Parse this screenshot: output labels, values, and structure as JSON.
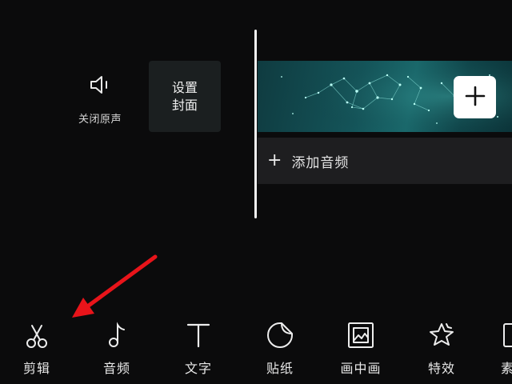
{
  "controls": {
    "mute_label": "关闭原声",
    "cover_line1": "设置",
    "cover_line2": "封面"
  },
  "timeline": {
    "add_audio_label": "添加音频"
  },
  "toolbar": {
    "items": [
      {
        "label": "剪辑",
        "icon": "scissors-icon"
      },
      {
        "label": "音频",
        "icon": "music-note-icon"
      },
      {
        "label": "文字",
        "icon": "text-icon"
      },
      {
        "label": "贴纸",
        "icon": "sticker-icon"
      },
      {
        "label": "画中画",
        "icon": "picture-in-picture-icon"
      },
      {
        "label": "特效",
        "icon": "effects-star-icon"
      },
      {
        "label": "素",
        "icon": "material-icon"
      }
    ]
  },
  "colors": {
    "background": "#0b0b0c",
    "annotation_arrow": "#e8141a",
    "clip_teal": "#145459"
  }
}
